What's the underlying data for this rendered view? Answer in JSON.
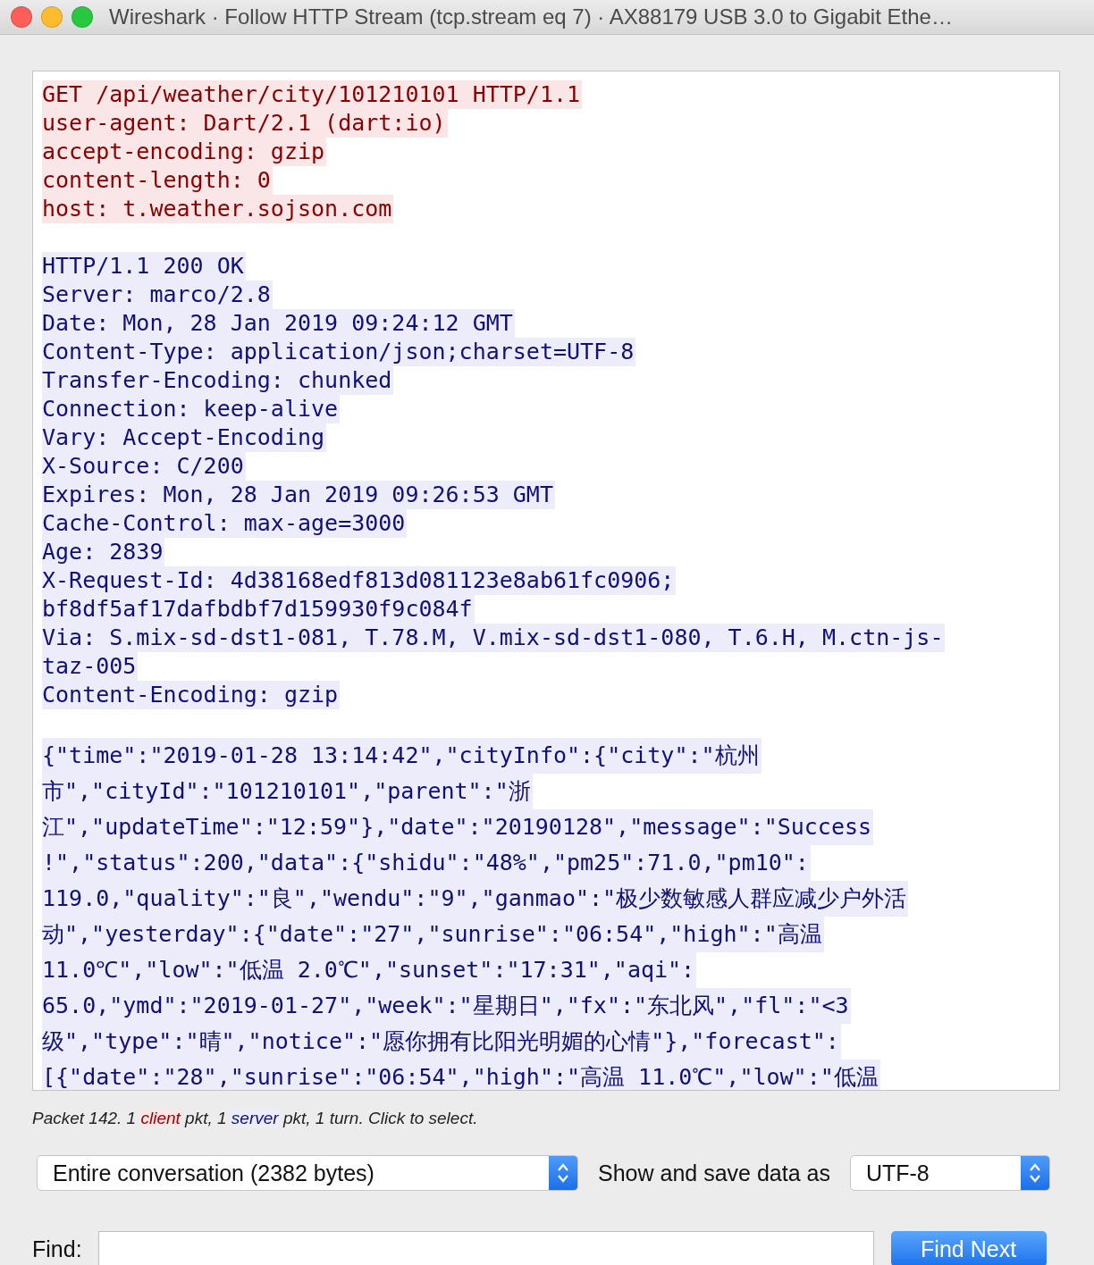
{
  "window": {
    "title": "Wireshark · Follow HTTP Stream (tcp.stream eq 7) · AX88179 USB 3.0 to Gigabit Ethe…"
  },
  "stream": [
    {
      "kind": "client",
      "lines": [
        "GET /api/weather/city/101210101 HTTP/1.1",
        "user-agent: Dart/2.1 (dart:io)",
        "accept-encoding: gzip",
        "content-length: 0",
        "host: t.weather.sojson.com"
      ]
    },
    {
      "kind": "server",
      "lines": [
        "HTTP/1.1 200 OK",
        "Server: marco/2.8",
        "Date: Mon, 28 Jan 2019 09:24:12 GMT",
        "Content-Type: application/json;charset=UTF-8",
        "Transfer-Encoding: chunked",
        "Connection: keep-alive",
        "Vary: Accept-Encoding",
        "X-Source: C/200",
        "Expires: Mon, 28 Jan 2019 09:26:53 GMT",
        "Cache-Control: max-age=3000",
        "Age: 2839",
        "X-Request-Id: 4d38168edf813d081123e8ab61fc0906;",
        "bf8df5af17dafbdbf7d159930f9c084f",
        "Via: S.mix-sd-dst1-081, T.78.M, V.mix-sd-dst1-080, T.6.H, M.ctn-js-",
        "taz-005",
        "Content-Encoding: gzip"
      ]
    },
    {
      "kind": "server",
      "lines": [
        "{\"time\":\"2019-01-28 13:14:42\",\"cityInfo\":{\"city\":\"杭州",
        "市\",\"cityId\":\"101210101\",\"parent\":\"浙",
        "江\",\"updateTime\":\"12:59\"},\"date\":\"20190128\",\"message\":\"Success",
        "!\",\"status\":200,\"data\":{\"shidu\":\"48%\",\"pm25\":71.0,\"pm10\":",
        "119.0,\"quality\":\"良\",\"wendu\":\"9\",\"ganmao\":\"极少数敏感人群应减少户外活",
        "动\",\"yesterday\":{\"date\":\"27\",\"sunrise\":\"06:54\",\"high\":\"高温",
        "11.0℃\",\"low\":\"低温 2.0℃\",\"sunset\":\"17:31\",\"aqi\":",
        "65.0,\"ymd\":\"2019-01-27\",\"week\":\"星期日\",\"fx\":\"东北风\",\"fl\":\"<3",
        "级\",\"type\":\"晴\",\"notice\":\"愿你拥有比阳光明媚的心情\"},\"forecast\":",
        "[{\"date\":\"28\",\"sunrise\":\"06:54\",\"high\":\"高温 11.0℃\",\"low\":\"低温"
      ]
    }
  ],
  "status_text": "Packet 142. 1 *client* pkt, 1 *server* pkt, 1 turn. Click to select.",
  "conversation_select": {
    "value": "Entire conversation (2382 bytes)"
  },
  "format_label": "Show and save data as",
  "format_select": {
    "value": "UTF-8"
  },
  "find": {
    "label": "Find:",
    "button": "Find Next"
  }
}
